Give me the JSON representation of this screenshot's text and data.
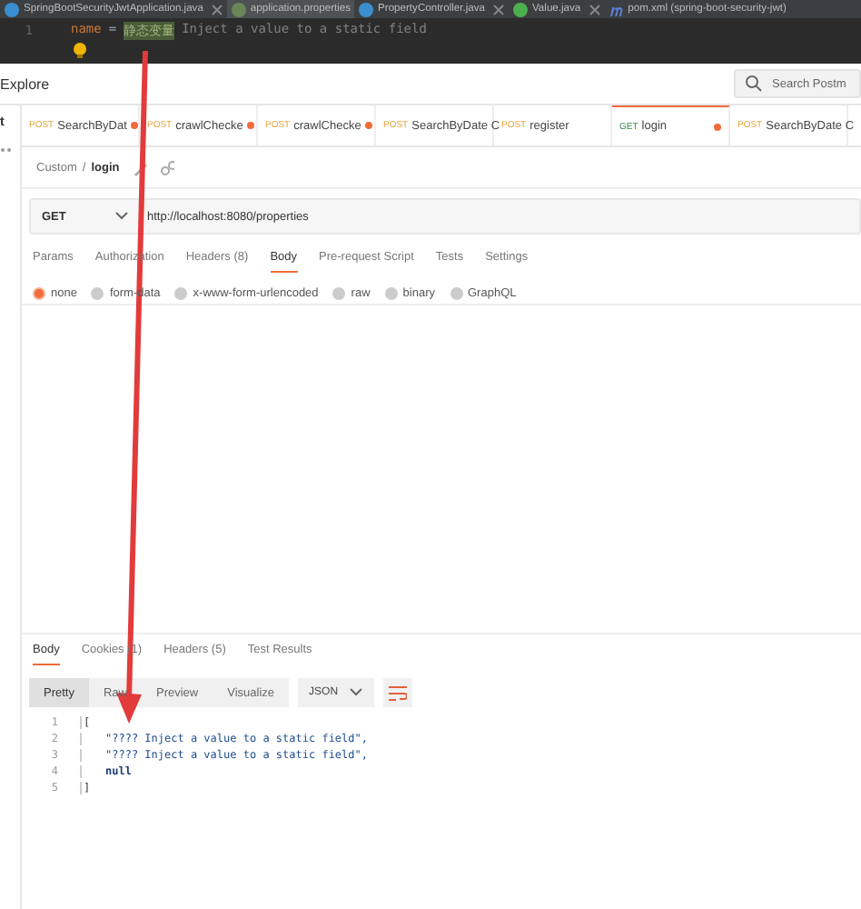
{
  "editor": {
    "tabs": [
      {
        "label": "SpringBootSecurityJwtApplication.java",
        "kind": "class",
        "closable": true,
        "selected": false
      },
      {
        "label": "application.properties",
        "kind": "properties",
        "closable": false,
        "selected": true
      },
      {
        "label": "PropertyController.java",
        "kind": "class",
        "closable": true,
        "selected": false
      },
      {
        "label": "Value.java",
        "kind": "annotation",
        "closable": true,
        "selected": false
      },
      {
        "label": "pom.xml (spring-boot-security-jwt)",
        "kind": "maven",
        "closable": false,
        "selected": false
      }
    ],
    "lines": [
      {
        "number": "1",
        "key": "name",
        "sep": "=",
        "highlighted": "静态变量",
        "rest": "Inject a value to a static field"
      }
    ]
  },
  "postman": {
    "nav": {
      "title": "Explore",
      "search": {
        "placeholder": "Search Postm"
      }
    },
    "sidebar": [
      "t"
    ],
    "tabs": [
      {
        "method": "POST",
        "name": "SearchByDat",
        "unsaved": true,
        "selected": false
      },
      {
        "method": "POST",
        "name": "crawlChecke",
        "unsaved": true,
        "selected": false
      },
      {
        "method": "POST",
        "name": "crawlChecke",
        "unsaved": true,
        "selected": false
      },
      {
        "method": "POST",
        "name": "SearchByDate C",
        "unsaved": false,
        "selected": false
      },
      {
        "method": "POST",
        "name": "register",
        "unsaved": false,
        "selected": false
      },
      {
        "method": "GET",
        "name": "login",
        "unsaved": true,
        "selected": true
      },
      {
        "method": "POST",
        "name": "SearchByDate C",
        "unsaved": false,
        "selected": false
      }
    ],
    "breadcrumb": {
      "parent": "Custom",
      "separator": "/",
      "current": "login"
    },
    "request": {
      "method": "GET",
      "url": "http://localhost:8080/properties"
    },
    "request_tabs": [
      {
        "label": "Params",
        "selected": false
      },
      {
        "label": "Authorization",
        "selected": false
      },
      {
        "label": "Headers (8)",
        "selected": false
      },
      {
        "label": "Body",
        "selected": true
      },
      {
        "label": "Pre-request Script",
        "selected": false
      },
      {
        "label": "Tests",
        "selected": false
      },
      {
        "label": "Settings",
        "selected": false
      }
    ],
    "body_types": [
      {
        "label": "none",
        "selected": true
      },
      {
        "label": "form-data",
        "selected": false
      },
      {
        "label": "x-www-form-urlencoded",
        "selected": false
      },
      {
        "label": "raw",
        "selected": false
      },
      {
        "label": "binary",
        "selected": false
      },
      {
        "label": "GraphQL",
        "selected": false
      }
    ],
    "response_tabs": [
      {
        "label": "Body",
        "selected": true
      },
      {
        "label": "Cookies (1)",
        "selected": false
      },
      {
        "label": "Headers (5)",
        "selected": false
      },
      {
        "label": "Test Results",
        "selected": false
      }
    ],
    "view_modes": [
      {
        "label": "Pretty",
        "selected": true
      },
      {
        "label": "Raw",
        "selected": false
      },
      {
        "label": "Preview",
        "selected": false
      },
      {
        "label": "Visualize",
        "selected": false
      }
    ],
    "format": "JSON",
    "response_lines": [
      {
        "number": "1",
        "text": "[",
        "kind": "bracket"
      },
      {
        "number": "2",
        "text": "\"???? Inject a value to a static field\",",
        "kind": "string"
      },
      {
        "number": "3",
        "text": "\"???? Inject a value to a static field\",",
        "kind": "string"
      },
      {
        "number": "4",
        "text": "null",
        "kind": "keyword"
      },
      {
        "number": "5",
        "text": "]",
        "kind": "bracket"
      }
    ]
  },
  "annotation": {
    "kind": "arrow"
  }
}
